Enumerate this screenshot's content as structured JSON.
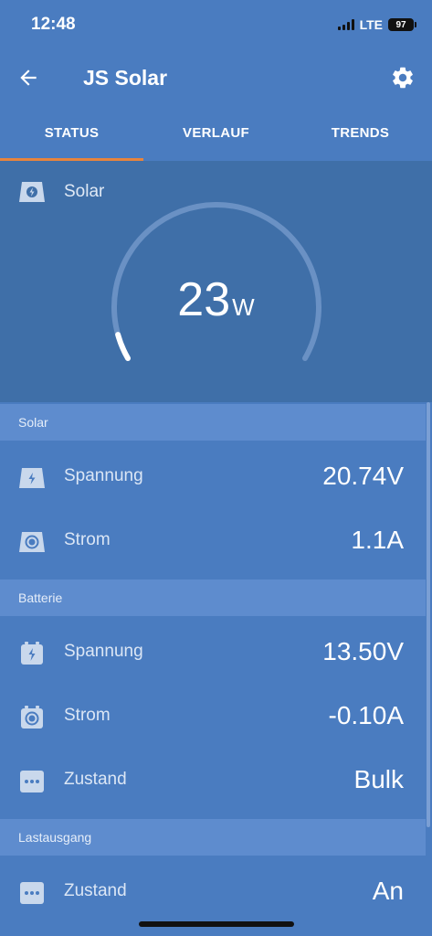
{
  "status_bar": {
    "time": "12:48",
    "network": "LTE",
    "battery": "97"
  },
  "app_bar": {
    "title": "JS Solar",
    "back_icon": "arrow-left-icon",
    "settings_icon": "gear-icon"
  },
  "tabs": [
    {
      "label": "STATUS",
      "active": true
    },
    {
      "label": "VERLAUF",
      "active": false
    },
    {
      "label": "TRENDS",
      "active": false
    }
  ],
  "gauge": {
    "title": "Solar",
    "value": "23",
    "unit": "W",
    "fill_fraction": 0.06
  },
  "sections": [
    {
      "title": "Solar",
      "rows": [
        {
          "icon": "solar-bolt-icon",
          "label": "Spannung",
          "value": "20.74V"
        },
        {
          "icon": "solar-current-icon",
          "label": "Strom",
          "value": "1.1A"
        }
      ]
    },
    {
      "title": "Batterie",
      "rows": [
        {
          "icon": "battery-bolt-icon",
          "label": "Spannung",
          "value": "13.50V"
        },
        {
          "icon": "battery-current-icon",
          "label": "Strom",
          "value": "-0.10A"
        },
        {
          "icon": "more-dots-icon",
          "label": "Zustand",
          "value": "Bulk"
        }
      ]
    },
    {
      "title": "Lastausgang",
      "rows": [
        {
          "icon": "more-dots-icon",
          "label": "Zustand",
          "value": "An"
        }
      ]
    }
  ],
  "colors": {
    "background": "#4a7cc0",
    "panel": "#3f6fa8",
    "section_header": "#5e8cce",
    "tab_indicator": "#e8843c"
  }
}
